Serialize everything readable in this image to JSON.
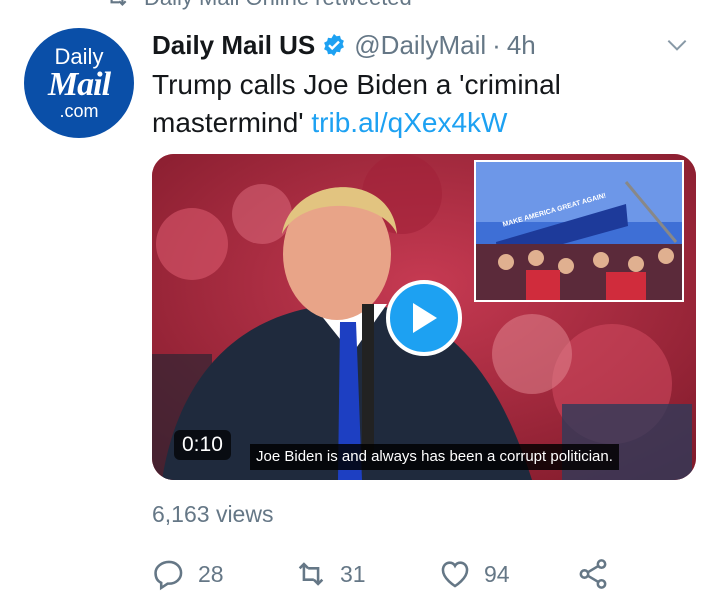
{
  "retweet_context": {
    "label": "Daily Mail Online retweeted",
    "icon": "retweet-icon"
  },
  "avatar": {
    "line1": "Daily",
    "line2": "Mail",
    "line3": ".com",
    "bg_color": "#0a4fa8"
  },
  "tweet": {
    "author_name": "Daily Mail US",
    "verified": true,
    "handle": "@DailyMail",
    "separator": "·",
    "time": "4h",
    "text": "Trump calls Joe Biden a 'criminal mastermind' ",
    "link": "trib.al/qXex4kW"
  },
  "media": {
    "type": "video",
    "duration": "0:10",
    "caption": "Joe Biden is and always has been a corrupt politician.",
    "inset_banner": "MAKE AMERICA GREAT AGAIN!",
    "play_icon": "play-icon"
  },
  "views": "6,163 views",
  "actions": {
    "reply_count": "28",
    "retweet_count": "31",
    "like_count": "94",
    "share_icon": "share-icon"
  },
  "colors": {
    "accent": "#1da1f2",
    "muted": "#657786",
    "text": "#14171a"
  }
}
